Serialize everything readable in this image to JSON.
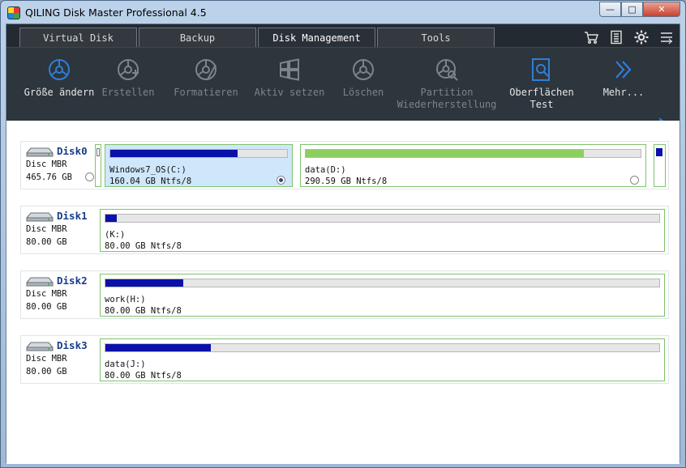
{
  "window": {
    "title": "QILING Disk Master Professional 4.5",
    "controls": {
      "minimize": "—",
      "maximize": "□",
      "close": "✕"
    }
  },
  "tabs": [
    {
      "label": "Virtual Disk",
      "active": false
    },
    {
      "label": "Backup",
      "active": false
    },
    {
      "label": "Disk Management",
      "active": true
    },
    {
      "label": "Tools",
      "active": false
    }
  ],
  "top_icons": [
    "cart-icon",
    "list-icon",
    "gear-icon",
    "menu-icon"
  ],
  "toolbar": {
    "resize": "Größe ändern",
    "create": "Erstellen",
    "format": "Formatieren",
    "set_active": "Aktiv setzen",
    "delete": "Löschen",
    "recovery_line1": "Partition",
    "recovery_line2": "Wiederherstellung",
    "surface_line1": "Oberflächen",
    "surface_line2": "Test",
    "more": "Mehr..."
  },
  "colors": {
    "accent": "#2f7fd6",
    "used_system": "#0a11a8",
    "used_data": "#8ccf5f",
    "partition_border": "#7fc36e",
    "selected_bg": "#cfe7fb"
  },
  "disks": [
    {
      "name": "Disk0",
      "type": "Disc MBR",
      "size": "465.76 GB",
      "partitions": [
        {
          "label": "Windows7_OS(C:)",
          "size": "160.04 GB Ntfs/8",
          "used": 0.72,
          "selected": true
        },
        {
          "label": "data(D:)",
          "size": "290.59 GB Ntfs/8",
          "used": 0.83,
          "selected": false
        }
      ]
    },
    {
      "name": "Disk1",
      "type": "Disc MBR",
      "size": "80.00 GB",
      "partitions": [
        {
          "label": "(K:)",
          "size": "80.00 GB Ntfs/8",
          "used": 0.02
        }
      ]
    },
    {
      "name": "Disk2",
      "type": "Disc MBR",
      "size": "80.00 GB",
      "partitions": [
        {
          "label": "work(H:)",
          "size": "80.00 GB Ntfs/8",
          "used": 0.14
        }
      ]
    },
    {
      "name": "Disk3",
      "type": "Disc MBR",
      "size": "80.00 GB",
      "partitions": [
        {
          "label": "data(J:)",
          "size": "80.00 GB Ntfs/8",
          "used": 0.19
        }
      ]
    }
  ]
}
